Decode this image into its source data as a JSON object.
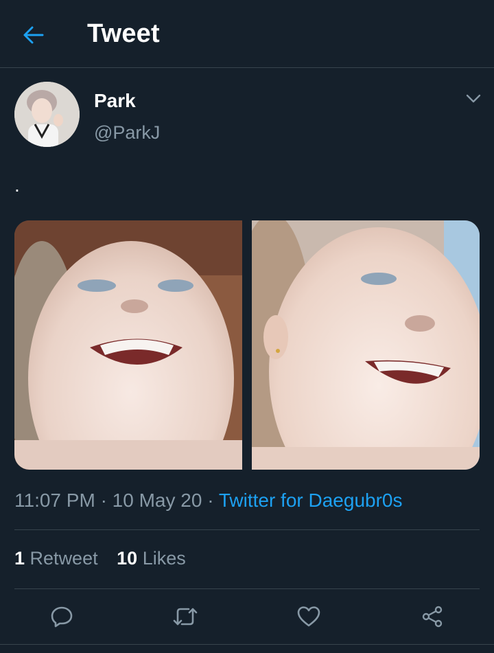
{
  "header": {
    "title": "Tweet",
    "back_icon": "arrow-left-icon",
    "accent": "#1da1f2"
  },
  "author": {
    "name": "Park",
    "handle": "@ParkJ"
  },
  "tweet": {
    "text": ".",
    "time": "11:07 PM",
    "date": "10 May 20",
    "separator": "·",
    "source": "Twitter for Daegubr0s"
  },
  "stats": {
    "retweets_count": "1",
    "retweets_label": "Retweet",
    "likes_count": "10",
    "likes_label": "Likes"
  },
  "actions": [
    "reply-icon",
    "retweet-icon",
    "like-icon",
    "share-icon"
  ],
  "colors": {
    "background": "#15202b",
    "text": "#ffffff",
    "secondary": "#8899a6",
    "divider": "#38444d",
    "link": "#1da1f2"
  }
}
